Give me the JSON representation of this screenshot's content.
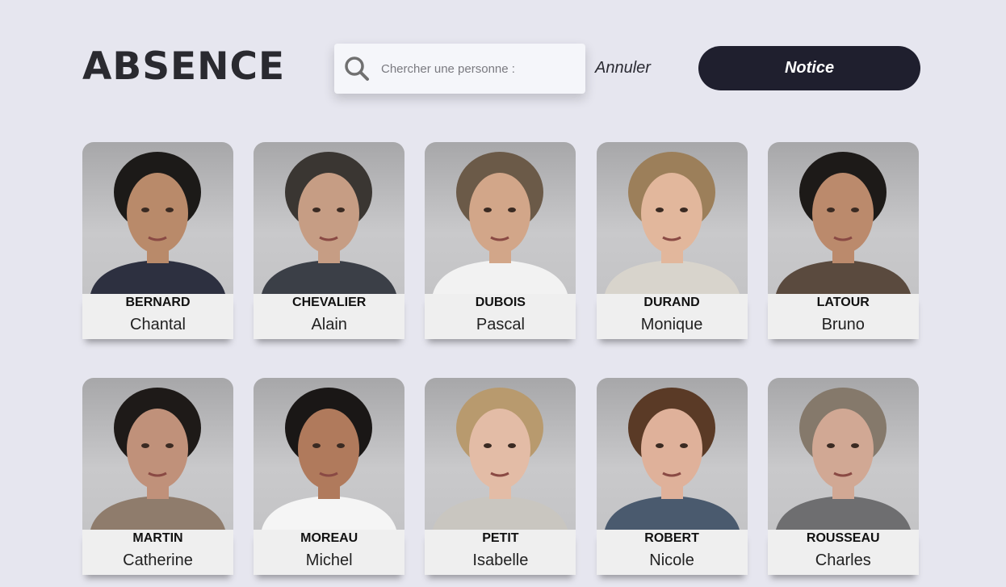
{
  "header": {
    "logo": "ABSENCE",
    "search_placeholder": "Chercher une personne :",
    "search_value": "",
    "cancel_label": "Annuler",
    "notice_label": "Notice"
  },
  "colors": {
    "background": "#e6e6ef",
    "button": "#1f1f2e",
    "plate": "#efefef"
  },
  "people": [
    {
      "last": "BERNARD",
      "first": "Chantal",
      "skin": "#b98a6a",
      "hair": "#1c1a18",
      "shirt": "#2d3040",
      "icon": "portrait-photo"
    },
    {
      "last": "CHEVALIER",
      "first": "Alain",
      "skin": "#c69d84",
      "hair": "#3a3632",
      "shirt": "#3b3f47",
      "icon": "portrait-photo"
    },
    {
      "last": "DUBOIS",
      "first": "Pascal",
      "skin": "#d2a689",
      "hair": "#6b5a48",
      "shirt": "#f2f2f2",
      "icon": "portrait-photo"
    },
    {
      "last": "DURAND",
      "first": "Monique",
      "skin": "#e2b79c",
      "hair": "#9c7f5a",
      "shirt": "#d8d4cc",
      "icon": "portrait-photo"
    },
    {
      "last": "LATOUR",
      "first": "Bruno",
      "skin": "#bb8a6c",
      "hair": "#1d1a18",
      "shirt": "#5a4a3e",
      "icon": "portrait-photo"
    },
    {
      "last": "MARTIN",
      "first": "Catherine",
      "skin": "#c0917a",
      "hair": "#1e1a18",
      "shirt": "#8f7c6c",
      "icon": "portrait-photo"
    },
    {
      "last": "MOREAU",
      "first": "Michel",
      "skin": "#b07a5c",
      "hair": "#1a1716",
      "shirt": "#f5f5f5",
      "icon": "portrait-photo"
    },
    {
      "last": "PETIT",
      "first": "Isabelle",
      "skin": "#e3bca6",
      "hair": "#b89a6e",
      "shirt": "#c9c6c0",
      "icon": "portrait-photo"
    },
    {
      "last": "ROBERT",
      "first": "Nicole",
      "skin": "#dfb19a",
      "hair": "#5a3a26",
      "shirt": "#4a5a6e",
      "icon": "portrait-photo"
    },
    {
      "last": "ROUSSEAU",
      "first": "Charles",
      "skin": "#d1a894",
      "hair": "#85796b",
      "shirt": "#6e6e70",
      "icon": "portrait-photo"
    }
  ]
}
